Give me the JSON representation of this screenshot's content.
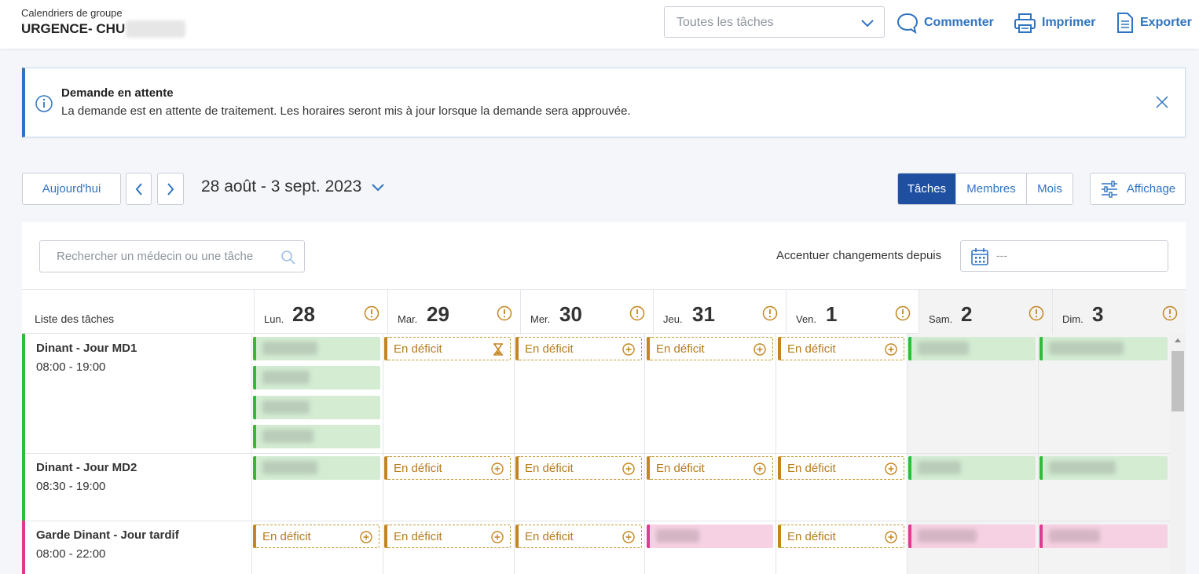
{
  "header": {
    "context_label": "Calendriers de groupe",
    "group_name": "URGENCE- CHU",
    "task_filter": {
      "placeholder": "Toutes les tâches"
    },
    "actions": {
      "comment": "Commenter",
      "print": "Imprimer",
      "export": "Exporter"
    }
  },
  "alert": {
    "title": "Demande en attente",
    "message": "La demande est en attente de traitement. Les horaires seront mis à jour lorsque la demande sera approuvée."
  },
  "toolbar": {
    "today": "Aujourd'hui",
    "date_range": "28 août - 3 sept. 2023",
    "views": [
      "Tâches",
      "Membres",
      "Mois"
    ],
    "active_view": "Tâches",
    "display": "Affichage"
  },
  "filters": {
    "search_placeholder": "Rechercher un médecin ou une tâche",
    "highlight_label": "Accentuer changements depuis",
    "highlight_value": "---"
  },
  "grid": {
    "list_header": "Liste des tâches",
    "days": [
      {
        "name": "Lun.",
        "num": "28",
        "weekend": false
      },
      {
        "name": "Mar.",
        "num": "29",
        "weekend": false
      },
      {
        "name": "Mer.",
        "num": "30",
        "weekend": false
      },
      {
        "name": "Jeu.",
        "num": "31",
        "weekend": false
      },
      {
        "name": "Ven.",
        "num": "1",
        "weekend": false
      },
      {
        "name": "Sam.",
        "num": "2",
        "weekend": true
      },
      {
        "name": "Dim.",
        "num": "3",
        "weekend": true
      }
    ],
    "deficit_label": "En déficit",
    "tasks": [
      {
        "name": "Dinant - Jour MD1",
        "hours": "08:00 - 19:00",
        "color": "#2fbb3b"
      },
      {
        "name": "Dinant - Jour MD2",
        "hours": "08:30 - 19:00",
        "color": "#2fbb3b"
      },
      {
        "name": "Garde Dinant - Jour tardif",
        "hours": "08:00 - 22:00",
        "color": "#e0398f"
      }
    ]
  },
  "colors": {
    "accent": "#2f74c0",
    "active_tab": "#1e4fa0",
    "assigned_green": "#d3ecd2",
    "assigned_pink": "#f6d1e3",
    "deficit": "#b57b1f"
  }
}
